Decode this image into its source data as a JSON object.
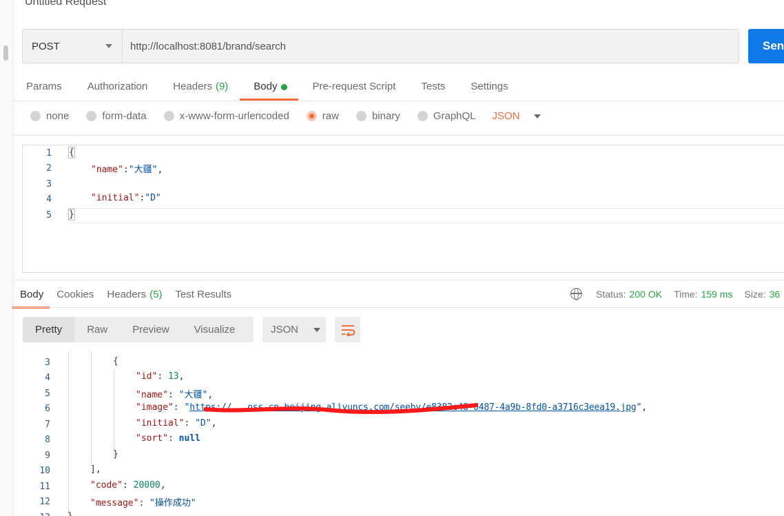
{
  "request": {
    "title": "Untitled Request",
    "method": "POST",
    "url": "http://localhost:8081/brand/search",
    "send_label": "Sen"
  },
  "request_tabs": [
    {
      "label": "Params",
      "count": ""
    },
    {
      "label": "Authorization",
      "count": ""
    },
    {
      "label": "Headers",
      "count": "(9)"
    },
    {
      "label": "Body",
      "count": ""
    },
    {
      "label": "Pre-request Script",
      "count": ""
    },
    {
      "label": "Tests",
      "count": ""
    },
    {
      "label": "Settings",
      "count": ""
    }
  ],
  "body_types": {
    "options": [
      "none",
      "form-data",
      "x-www-form-urlencoded",
      "raw",
      "binary",
      "GraphQL"
    ],
    "selected": "raw",
    "format": "JSON"
  },
  "request_body": {
    "line_numbers": [
      "1",
      "2",
      "3",
      "4",
      "5"
    ],
    "open_brace": "{",
    "name_key": "\"name\"",
    "name_sep": ":",
    "name_val": "\"大疆\"",
    "name_comma": ",",
    "initial_key": "\"initial\"",
    "initial_sep": ":",
    "initial_val": "\"D\"",
    "close_brace": "}"
  },
  "response_tabs": [
    {
      "label": "Body",
      "count": ""
    },
    {
      "label": "Cookies",
      "count": ""
    },
    {
      "label": "Headers",
      "count": "(5)"
    },
    {
      "label": "Test Results",
      "count": ""
    }
  ],
  "status": {
    "status_label": "Status:",
    "status_value": "200 OK",
    "time_label": "Time:",
    "time_value": "159 ms",
    "size_label": "Size:",
    "size_value": "36"
  },
  "response_view": {
    "modes": [
      "Pretty",
      "Raw",
      "Preview",
      "Visualize"
    ],
    "active_mode": "Pretty",
    "format": "JSON"
  },
  "response_body": {
    "line_numbers": [
      "3",
      "4",
      "5",
      "6",
      "7",
      "8",
      "9",
      "10",
      "11",
      "12",
      "13"
    ],
    "open_brace": "{",
    "id_key": "\"id\"",
    "id_val": "13",
    "name_key": "\"name\"",
    "name_val": "\"大疆\"",
    "image_key": "\"image\"",
    "image_open_quote": "\"",
    "image_url_visible": "https://...oss-cn-beijing.aliyuncs.com/seeby/e8382c48-0487-4a9b-8fd0-a3716c3eea19.jpg",
    "image_url_tail": "e8382c48-0487-4a9b-8fd0-a3716c3eea19.jpg",
    "initial_key": "\"initial\"",
    "initial_val": "\"D\"",
    "sort_key": "\"sort\"",
    "sort_val": "null",
    "close_brace": "}",
    "close_bracket": "],",
    "code_key": "\"code\"",
    "code_val": "20000",
    "message_key": "\"message\"",
    "message_val": "\"操作成功\"",
    "last_brace": "}"
  },
  "colors": {
    "accent": "#f26b3a",
    "send": "#0f79e8",
    "success": "#27a243"
  }
}
